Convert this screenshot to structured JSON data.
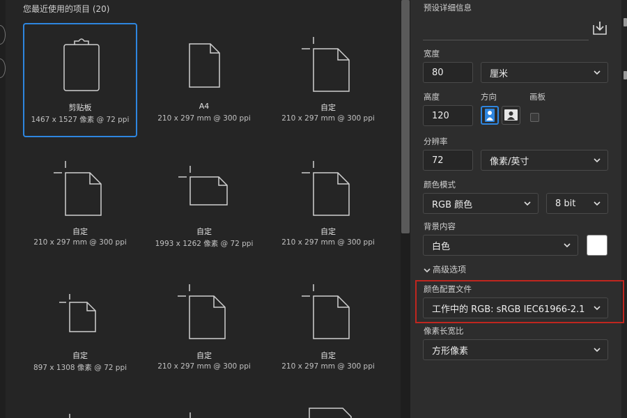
{
  "recent": {
    "title": "您最近使用的项目 (20)",
    "items": [
      {
        "name": "剪贴板",
        "size": "1467 x 1527 像素 @ 72 ppi",
        "icon": "clipboard-icon"
      },
      {
        "name": "A4",
        "size": "210 x 297 mm @ 300 ppi",
        "icon": "document-icon"
      },
      {
        "name": "自定",
        "size": "210 x 297 mm @ 300 ppi",
        "icon": "custom-document-icon"
      },
      {
        "name": "自定",
        "size": "210 x 297 mm @ 300 ppi",
        "icon": "custom-document-icon"
      },
      {
        "name": "自定",
        "size": "1993 x 1262 像素 @ 72 ppi",
        "icon": "custom-landscape-icon"
      },
      {
        "name": "自定",
        "size": "210 x 297 mm @ 300 ppi",
        "icon": "custom-document-icon"
      },
      {
        "name": "自定",
        "size": "897 x 1308 像素 @ 72 ppi",
        "icon": "custom-small-icon"
      },
      {
        "name": "自定",
        "size": "210 x 297 mm @ 300 ppi",
        "icon": "custom-document-icon"
      },
      {
        "name": "自定",
        "size": "210 x 297 mm @ 300 ppi",
        "icon": "custom-document-icon"
      }
    ]
  },
  "preset": {
    "title": "预设详细信息",
    "save_icon": "save-preset-icon",
    "width_label": "宽度",
    "width_value": "80",
    "width_unit": "厘米",
    "height_label": "高度",
    "height_value": "120",
    "orientation_label": "方向",
    "artboard_label": "画板",
    "resolution_label": "分辨率",
    "resolution_value": "72",
    "resolution_unit": "像素/英寸",
    "color_mode_label": "颜色模式",
    "color_mode_value": "RGB 颜色",
    "bit_depth_value": "8 bit",
    "background_label": "背景内容",
    "background_value": "白色",
    "background_swatch": "#ffffff",
    "advanced_label": "高级选项",
    "color_profile_label": "颜色配置文件",
    "color_profile_value": "工作中的 RGB: sRGB IEC61966-2.1",
    "pixel_aspect_label": "像素长宽比",
    "pixel_aspect_value": "方形像素"
  },
  "colors": {
    "accent": "#2e86e0",
    "highlight": "#c0261f",
    "background": "#252525",
    "panel": "#2d2d2d"
  }
}
